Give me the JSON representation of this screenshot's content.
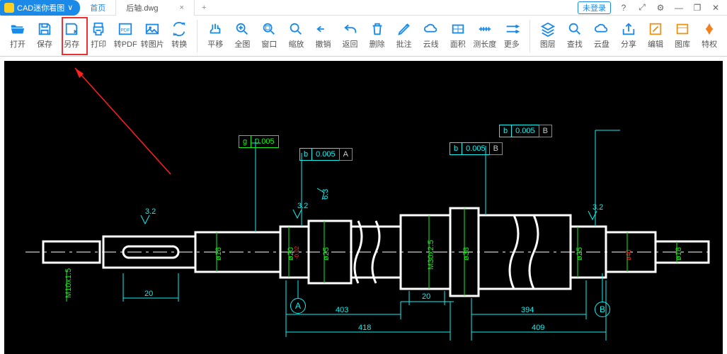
{
  "app": {
    "name": "CAD迷你看图",
    "dropdown": "∨"
  },
  "tabs": {
    "home": "首页",
    "active": "后轴.dwg",
    "plus": "+"
  },
  "titlebar_right": {
    "login": "未登录",
    "help": "?",
    "fullscreen": "⤢",
    "settings": "⚙",
    "min": "—",
    "restore": "❐",
    "close": "✕"
  },
  "toolbar": {
    "open": "打开",
    "save": "保存",
    "saveas": "另存",
    "print": "打印",
    "topdf": "转PDF",
    "toimg": "转图片",
    "convert": "转换",
    "pan": "平移",
    "zoomall": "全图",
    "window": "窗口",
    "zoom": "缩放",
    "undo": "撤销",
    "return": "返回",
    "delete": "删除",
    "annotate": "批注",
    "cloud": "云线",
    "area": "面积",
    "length": "测长度",
    "more": "更多",
    "layers": "图层",
    "find": "查找",
    "clouddisk": "云盘",
    "share": "分享",
    "edit": "编辑",
    "library": "图库",
    "vip": "特权"
  },
  "drawing_labels": {
    "g_tol": {
      "sym": "g",
      "val": "0.005"
    },
    "b_tol_A": {
      "sym": "b",
      "val": "0.005",
      "datum": "A"
    },
    "b_tol_B1": {
      "sym": "b",
      "val": "0.005",
      "datum": "B"
    },
    "b_tol_B2": {
      "sym": "b",
      "val": "0.005",
      "datum": "B"
    },
    "dim_20_a": "20",
    "dim_20_b": "20",
    "dim_403": "403",
    "dim_418": "418",
    "dim_394": "394",
    "dim_409": "409",
    "m10": "M10x1.5",
    "d18a": "ø18",
    "d20": "ø20",
    "d25a": "ø25",
    "m30": "M30x2.5",
    "d38": "ø38",
    "d25b": "ø25",
    "d18b": "ø18",
    "d20tol": "-0.02",
    "d40tol": "ø40",
    "ra63": "6.3",
    "ra32a": "3.2",
    "ra32b": "3.2",
    "ra32c": "3.2",
    "datum_A": "A",
    "datum_B": "B"
  }
}
